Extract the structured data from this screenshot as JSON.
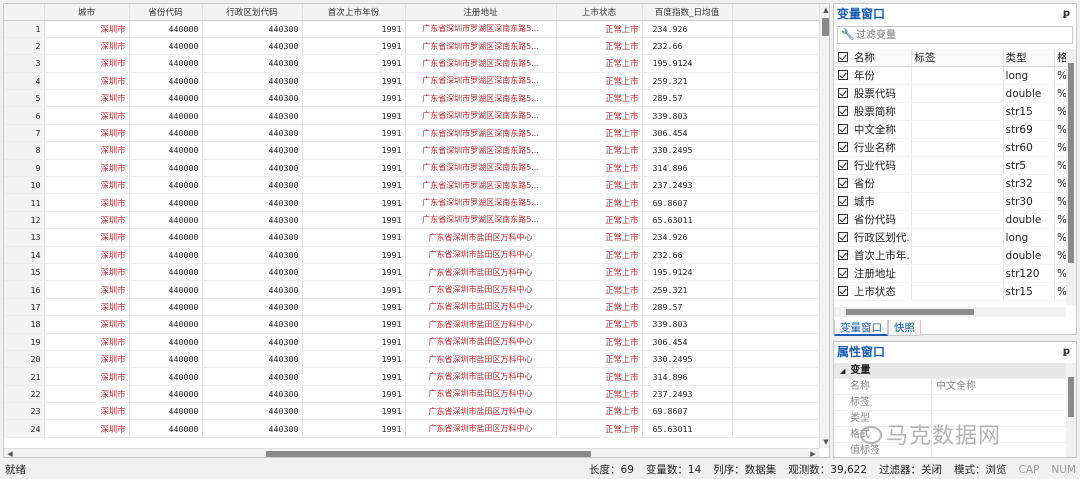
{
  "grid": {
    "columns": [
      "城市",
      "省份代码",
      "行政区划代码",
      "首次上市年份",
      "注册地址",
      "上市状态",
      "百度指数_日均值"
    ],
    "rows": [
      [
        "1",
        "深圳市",
        "440000",
        "440300",
        "1991",
        "广东省深圳市罗湖区深南东路5...",
        "正常上市",
        "234.926"
      ],
      [
        "2",
        "深圳市",
        "440000",
        "440300",
        "1991",
        "广东省深圳市罗湖区深南东路5...",
        "正常上市",
        "232.66"
      ],
      [
        "3",
        "深圳市",
        "440000",
        "440300",
        "1991",
        "广东省深圳市罗湖区深南东路5...",
        "正常上市",
        "195.9124"
      ],
      [
        "4",
        "深圳市",
        "440000",
        "440300",
        "1991",
        "广东省深圳市罗湖区深南东路5...",
        "正常上市",
        "259.321"
      ],
      [
        "5",
        "深圳市",
        "440000",
        "440300",
        "1991",
        "广东省深圳市罗湖区深南东路5...",
        "正常上市",
        "289.57"
      ],
      [
        "6",
        "深圳市",
        "440000",
        "440300",
        "1991",
        "广东省深圳市罗湖区深南东路5...",
        "正常上市",
        "339.803"
      ],
      [
        "7",
        "深圳市",
        "440000",
        "440300",
        "1991",
        "广东省深圳市罗湖区深南东路5...",
        "正常上市",
        "306.454"
      ],
      [
        "8",
        "深圳市",
        "440000",
        "440300",
        "1991",
        "广东省深圳市罗湖区深南东路5...",
        "正常上市",
        "330.2495"
      ],
      [
        "9",
        "深圳市",
        "440000",
        "440300",
        "1991",
        "广东省深圳市罗湖区深南东路5...",
        "正常上市",
        "314.896"
      ],
      [
        "10",
        "深圳市",
        "440000",
        "440300",
        "1991",
        "广东省深圳市罗湖区深南东路5...",
        "正常上市",
        "237.2493"
      ],
      [
        "11",
        "深圳市",
        "440000",
        "440300",
        "1991",
        "广东省深圳市罗湖区深南东路5...",
        "正常上市",
        "69.8607"
      ],
      [
        "12",
        "深圳市",
        "440000",
        "440300",
        "1991",
        "广东省深圳市罗湖区深南东路5...",
        "正常上市",
        "65.63011"
      ],
      [
        "13",
        "深圳市",
        "440000",
        "440300",
        "1991",
        "广东省深圳市盐田区万科中心",
        "正常上市",
        "234.926"
      ],
      [
        "14",
        "深圳市",
        "440000",
        "440300",
        "1991",
        "广东省深圳市盐田区万科中心",
        "正常上市",
        "232.66"
      ],
      [
        "15",
        "深圳市",
        "440000",
        "440300",
        "1991",
        "广东省深圳市盐田区万科中心",
        "正常上市",
        "195.9124"
      ],
      [
        "16",
        "深圳市",
        "440000",
        "440300",
        "1991",
        "广东省深圳市盐田区万科中心",
        "正常上市",
        "259.321"
      ],
      [
        "17",
        "深圳市",
        "440000",
        "440300",
        "1991",
        "广东省深圳市盐田区万科中心",
        "正常上市",
        "289.57"
      ],
      [
        "18",
        "深圳市",
        "440000",
        "440300",
        "1991",
        "广东省深圳市盐田区万科中心",
        "正常上市",
        "339.803"
      ],
      [
        "19",
        "深圳市",
        "440000",
        "440300",
        "1991",
        "广东省深圳市盐田区万科中心",
        "正常上市",
        "306.454"
      ],
      [
        "20",
        "深圳市",
        "440000",
        "440300",
        "1991",
        "广东省深圳市盐田区万科中心",
        "正常上市",
        "330.2495"
      ],
      [
        "21",
        "深圳市",
        "440000",
        "440300",
        "1991",
        "广东省深圳市盐田区万科中心",
        "正常上市",
        "314.896"
      ],
      [
        "22",
        "深圳市",
        "440000",
        "440300",
        "1991",
        "广东省深圳市盐田区万科中心",
        "正常上市",
        "237.2493"
      ],
      [
        "23",
        "深圳市",
        "440000",
        "440300",
        "1991",
        "广东省深圳市盐田区万科中心",
        "正常上市",
        "69.8607"
      ],
      [
        "24",
        "深圳市",
        "440000",
        "440300",
        "1991",
        "广东省深圳市盐田区万科中心",
        "正常上市",
        "65.63011"
      ]
    ]
  },
  "variables": {
    "title": "变量窗口",
    "filter_placeholder": "过滤变量",
    "headers": {
      "name": "名称",
      "label": "标签",
      "type": "类型",
      "format": "格"
    },
    "items": [
      {
        "name": "年份",
        "type": "long",
        "format": "%"
      },
      {
        "name": "股票代码",
        "type": "double",
        "format": "%"
      },
      {
        "name": "股票简称",
        "type": "str15",
        "format": "%"
      },
      {
        "name": "中文全称",
        "type": "str69",
        "format": "%"
      },
      {
        "name": "行业名称",
        "type": "str60",
        "format": "%"
      },
      {
        "name": "行业代码",
        "type": "str5",
        "format": "%"
      },
      {
        "name": "省份",
        "type": "str32",
        "format": "%"
      },
      {
        "name": "城市",
        "type": "str30",
        "format": "%"
      },
      {
        "name": "省份代码",
        "type": "double",
        "format": "%"
      },
      {
        "name": "行政区划代...",
        "type": "long",
        "format": "%"
      },
      {
        "name": "首次上市年...",
        "type": "double",
        "format": "%"
      },
      {
        "name": "注册地址",
        "type": "str120",
        "format": "%"
      },
      {
        "name": "上市状态",
        "type": "str15",
        "format": "%"
      }
    ],
    "tabs": [
      "变量窗口",
      "快照"
    ]
  },
  "properties": {
    "title": "属性窗口",
    "group": "变量",
    "rows": [
      {
        "key": "名称",
        "value": "中文全称"
      },
      {
        "key": "标签",
        "value": ""
      },
      {
        "key": "类型",
        "value": ""
      },
      {
        "key": "格式",
        "value": ""
      },
      {
        "key": "值标签",
        "value": ""
      }
    ]
  },
  "watermark": "马克数据网",
  "status": {
    "ready": "就绪",
    "length": "长度：69",
    "vars": "变量数：14",
    "order": "列序：数据集",
    "obs": "观测数：39,622",
    "filter": "过滤器：关闭",
    "mode": "模式：浏览",
    "cap": "CAP",
    "num": "NUM"
  }
}
